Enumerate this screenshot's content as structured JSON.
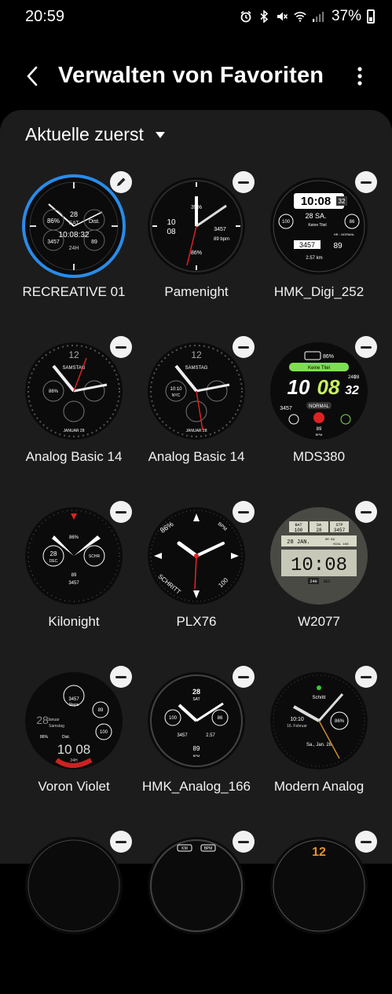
{
  "status_bar": {
    "time": "20:59",
    "battery": "37%",
    "icons": [
      "alarm-icon",
      "bluetooth-icon",
      "mute-icon",
      "wifi-icon",
      "signal-icon",
      "battery-icon"
    ]
  },
  "header": {
    "title": "Verwalten von Favoriten",
    "back_icon": "back-arrow-icon",
    "more_icon": "more-vertical-icon"
  },
  "sort": {
    "label": "Aktuelle zuerst",
    "icon": "caret-down-icon"
  },
  "accent_color": "#2a8be8",
  "faces": [
    {
      "name": "RECREATIVE 01",
      "action": "edit",
      "selected": true,
      "texts": [
        "86%",
        "28",
        "SAT",
        "Dist.",
        "3457",
        "89",
        "10:08:32",
        "24H"
      ]
    },
    {
      "name": "Pamenight",
      "action": "remove",
      "texts": [
        "35%",
        "10",
        "08",
        "3457",
        "89 bpm",
        "86%"
      ]
    },
    {
      "name": "HMK_Digi_252",
      "action": "remove",
      "texts": [
        "10:08",
        "32",
        "28 SA.",
        "Keine Titel",
        "100",
        "86",
        "3457",
        "89",
        "HR - NORMAL",
        "2.57 km"
      ]
    },
    {
      "name": "Analog Basic 14",
      "action": "remove",
      "texts": [
        "12",
        "SAMSTAG",
        "86%",
        "JANUAR 28"
      ]
    },
    {
      "name": "Analog Basic 14",
      "action": "remove",
      "texts": [
        "12",
        "SAMSTAG",
        "10:10",
        "NYC",
        "JANUAR 28"
      ]
    },
    {
      "name": "MDS380",
      "action": "remove",
      "texts": [
        "86%",
        "Keine Titel",
        "10",
        "08",
        "32",
        "24h",
        "28",
        "3457",
        "NORMAL",
        "89",
        "BPM"
      ]
    },
    {
      "name": "Kilonight",
      "action": "remove",
      "texts": [
        "86%",
        "28",
        "DEC",
        "SCHR",
        "89",
        "3457"
      ]
    },
    {
      "name": "PLX76",
      "action": "remove",
      "texts": [
        "86%",
        "BPM",
        "SCHRITT",
        "100"
      ]
    },
    {
      "name": "W2077",
      "action": "remove",
      "texts": [
        "BAT",
        "100",
        "SA",
        "28",
        "STP",
        "3457",
        "28 JAN.",
        "HR 89",
        "KCAL 166",
        "10:08",
        "24H",
        "SEC"
      ]
    },
    {
      "name": "Voron Violet",
      "action": "remove",
      "texts": [
        "3457",
        "Steps",
        "Januar",
        "28",
        "Samstag",
        "89",
        "86%",
        "Dist.",
        "10 08",
        "24H",
        "100"
      ]
    },
    {
      "name": "HMK_Analog_166",
      "action": "remove",
      "texts": [
        "28",
        "SAT",
        "100",
        "86",
        "3457",
        "2.57",
        "89",
        "BPM"
      ]
    },
    {
      "name": "Modern Analog",
      "action": "remove",
      "texts": [
        "Schritt",
        "10:10",
        "16. Februar",
        "86%",
        "Sa., Jan. 28"
      ]
    },
    {
      "name": "",
      "action": "remove",
      "texts": []
    },
    {
      "name": "",
      "action": "remove",
      "texts": [
        "KM",
        "BPM"
      ]
    },
    {
      "name": "",
      "action": "remove",
      "texts": [
        "12"
      ]
    }
  ]
}
